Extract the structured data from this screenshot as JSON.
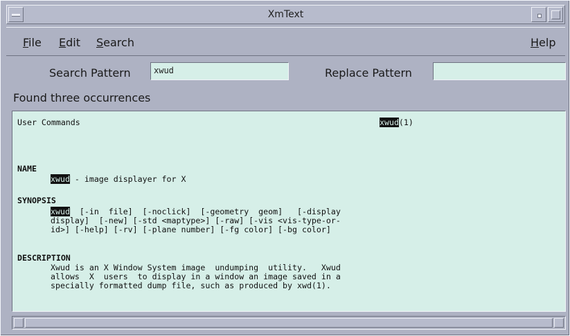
{
  "window": {
    "title": "XmText"
  },
  "menubar": {
    "file": {
      "mnemonic": "F",
      "rest": "ile"
    },
    "edit": {
      "mnemonic": "E",
      "rest": "dit"
    },
    "search": {
      "mnemonic": "S",
      "rest": "earch"
    },
    "help": {
      "mnemonic": "H",
      "rest": "elp"
    }
  },
  "search": {
    "search_label": "Search Pattern",
    "search_value": "xwud",
    "replace_label": "Replace Pattern",
    "replace_value": ""
  },
  "status": "Found three occurrences",
  "manpage": {
    "header_left": "User Commands",
    "header_cmd": "xwud",
    "header_section": "(1)",
    "name_heading": "NAME",
    "name_cmd": "xwud",
    "name_desc": " - image displayer for X",
    "synopsis_heading": "SYNOPSIS",
    "synopsis_cmd": "xwud",
    "synopsis_line1": "  [-in  file]  [-noclick]  [-geometry  geom]   [-display",
    "synopsis_line2": "display]  [-new] [-std <maptype>] [-raw] [-vis <vis-type-or-",
    "synopsis_line3": "id>] [-help] [-rv] [-plane number] [-fg color] [-bg color]",
    "description_heading": "DESCRIPTION",
    "description_line1": "Xwud is an X Window System image  undumping  utility.   Xwud",
    "description_line2": "allows  X  users  to display in a window an image saved in a",
    "description_line3": "specially formatted dump file, such as produced by xwd(1)."
  }
}
